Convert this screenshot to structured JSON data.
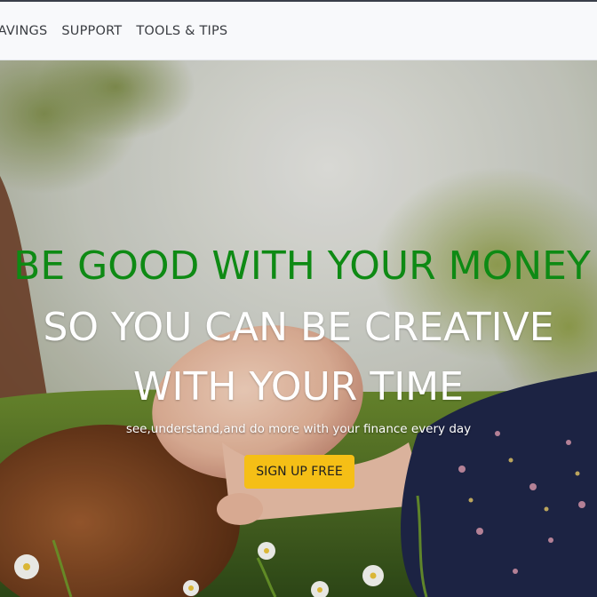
{
  "navbar": {
    "links": [
      {
        "label": "SAVINGS"
      },
      {
        "label": "SUPPORT"
      },
      {
        "label": "TOOLS & TIPS"
      }
    ]
  },
  "hero": {
    "headline_green": "BE GOOD WITH YOUR MONEY",
    "headline_white_line1": "SO YOU CAN BE CREATIVE",
    "headline_white_line2": "WITH YOUR TIME",
    "tagline": "see,understand,and do more with your finance every day",
    "cta_label": "SIGN UP FREE",
    "colors": {
      "headline_green": "#0e8a14",
      "cta_background": "#f5bf16",
      "navbar_background": "#f8f9fb"
    }
  }
}
